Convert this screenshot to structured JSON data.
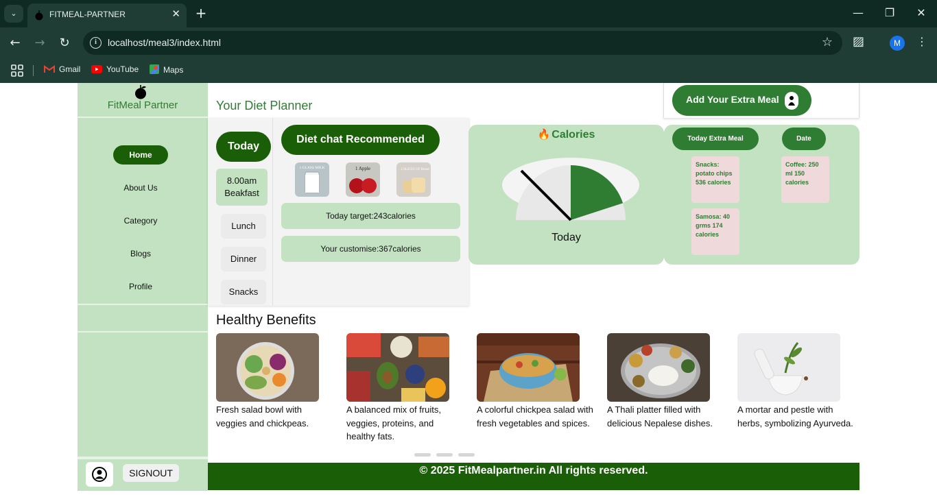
{
  "browser": {
    "tab_title": "FITMEAL-PARTNER",
    "tab_close": "✕",
    "new_tab": "+",
    "url": "localhost/meal3/index.html",
    "profile_initial": "M",
    "bookmarks": [
      "Gmail",
      "YouTube",
      "Maps"
    ]
  },
  "sidebar": {
    "brand": "FitMeal Partner",
    "nav": [
      "Home",
      "About Us",
      "Category",
      "Blogs",
      "Profile"
    ],
    "signout": "SIGNOUT"
  },
  "header": {
    "title": "Your Diet Planner",
    "extra_meal_button": "Add Your Extra Meal"
  },
  "planner": {
    "today": "Today",
    "meals": [
      "8.00am Beakfast",
      "Lunch",
      "Dinner",
      "Snacks"
    ],
    "diet_chat": "Diet chat Recommended",
    "food_labels": [
      "1 GLASS MILK",
      "1 Apple",
      "2 SLICES OF Bread"
    ],
    "target": "Today target:243calories",
    "customise": "Your customise:367calories"
  },
  "calories": {
    "title": "Calories",
    "caption": "Today",
    "fill_fraction": 0.4,
    "accent": "#2e7d32"
  },
  "extra_meal": {
    "col1_header": "Today Extra Meal",
    "col2_header": "Date",
    "notes_col1": [
      "Snacks: potato chips 536 calories",
      "Samosa: 40 grms 174 calories"
    ],
    "notes_col2": [
      "Coffee: 250 ml 150 calories"
    ]
  },
  "benefits": {
    "title": "Healthy Benefits",
    "items": [
      "Fresh salad bowl with veggies and chickpeas.",
      "A balanced mix of fruits, veggies, proteins, and healthy fats.",
      "A colorful chickpea salad with fresh vegetables and spices.",
      "A Thali platter filled with delicious Nepalese dishes.",
      "A mortar and pestle with herbs, symbolizing Ayurveda."
    ]
  },
  "footer": "© 2025 FitMealpartner.in All rights reserved.",
  "colors": {
    "brand_green": "#2e7d32",
    "dark_green": "#1b5e08",
    "mint": "#c3e2c2",
    "note_pink": "#f0d9da"
  }
}
